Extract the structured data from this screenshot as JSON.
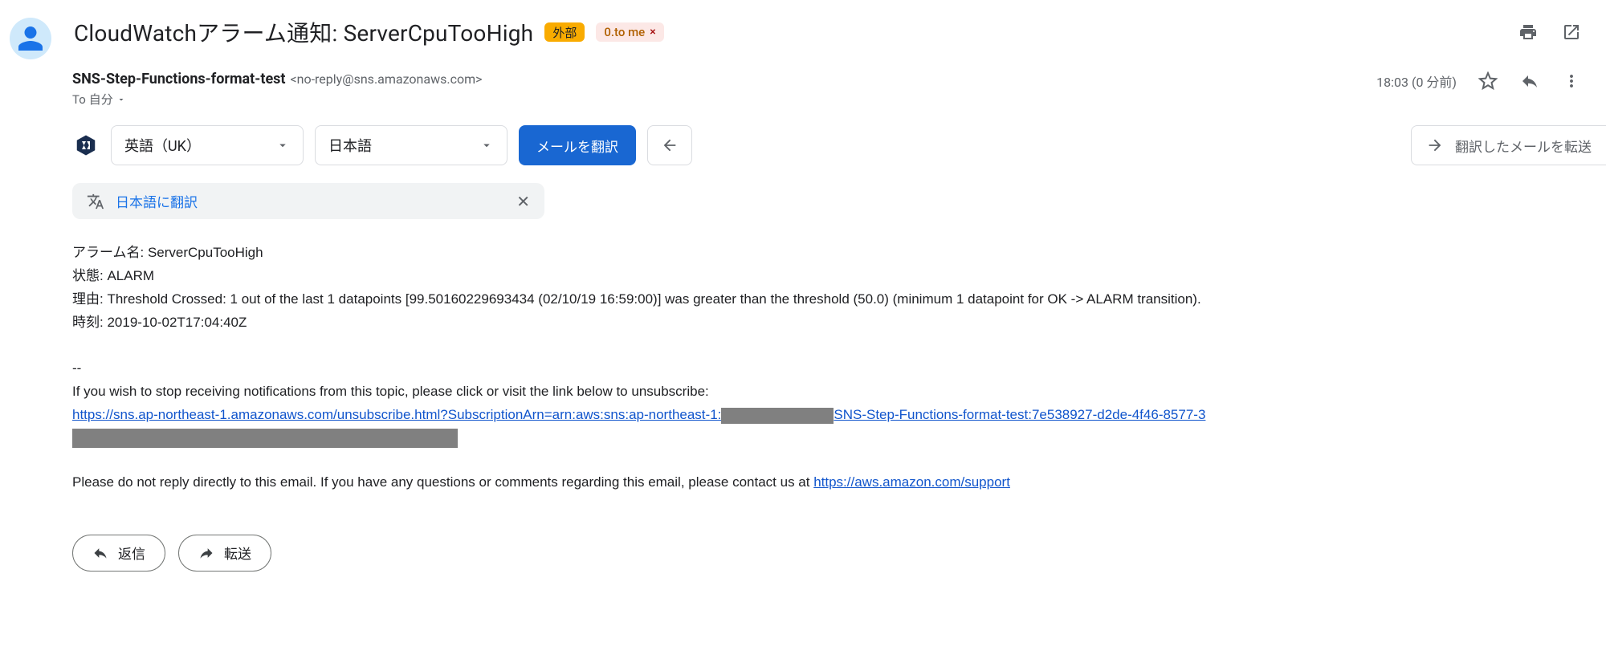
{
  "subject": "CloudWatchアラーム通知: ServerCpuTooHigh",
  "badges": {
    "external": "外部",
    "to_me": "0.to me",
    "to_me_x": "×"
  },
  "top_actions": {
    "print": "print",
    "new_window": "open-in-new"
  },
  "sender": {
    "name": "SNS-Step-Functions-format-test",
    "email": "<no-reply@sns.amazonaws.com>"
  },
  "to_line": {
    "prefix": "To",
    "value": "自分"
  },
  "meta": {
    "timestamp": "18:03 (0 分前)"
  },
  "translate": {
    "lang_from": "英語（UK）",
    "lang_to": "日本語",
    "button": "メールを翻訳",
    "forward_label": "翻訳したメールを転送",
    "chip_label": "日本語に翻訳"
  },
  "content": {
    "alarm_name_label": "アラーム名:",
    "alarm_name_value": "ServerCpuTooHigh",
    "state_label": "状態:",
    "state_value": "ALARM",
    "reason_label": "理由:",
    "reason_value": "Threshold Crossed: 1 out of the last 1 datapoints [99.50160229693434 (02/10/19 16:59:00)] was greater than the threshold (50.0) (minimum 1 datapoint for OK -> ALARM transition).",
    "time_label": "時刻:",
    "time_value": "2019-10-02T17:04:40Z",
    "separator": "--",
    "unsub_intro": "If you wish to stop receiving notifications from this topic, please click or visit the link below to unsubscribe:",
    "unsub_link_part1": "https://sns.ap-northeast-1.amazonaws.com/unsubscribe.html?SubscriptionArn=arn:aws:sns:ap-northeast-1:",
    "unsub_link_part2": "SNS-Step-Functions-format-test:7e538927-d2de-4f46-8577-3",
    "footer_text1": "Please do not reply directly to this email. If you have any questions or comments regarding this email, please contact us at ",
    "footer_link": "https://aws.amazon.com/support"
  },
  "actions": {
    "reply": "返信",
    "forward": "転送"
  }
}
